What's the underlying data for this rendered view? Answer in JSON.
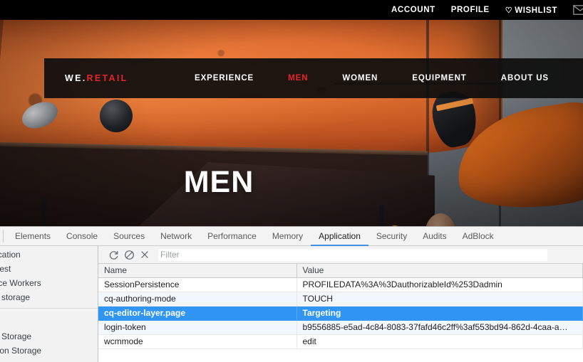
{
  "site": {
    "topbar": {
      "links": [
        {
          "label": "ACCOUNT",
          "name": "account-link"
        },
        {
          "label": "PROFILE",
          "name": "profile-link"
        },
        {
          "label": "WISHLIST",
          "name": "wishlist-link",
          "icon": "heart-icon",
          "icon_glyph": "♡"
        }
      ],
      "mail_icon": "mail-icon"
    },
    "brand": {
      "prefix": "WE.",
      "suffix": "RETAIL",
      "accent_color": "#e8242a"
    },
    "nav": [
      {
        "label": "EXPERIENCE",
        "active": false
      },
      {
        "label": "MEN",
        "active": true
      },
      {
        "label": "WOMEN",
        "active": false
      },
      {
        "label": "EQUIPMENT",
        "active": false
      },
      {
        "label": "ABOUT US",
        "active": false
      }
    ],
    "hero": {
      "title": "MEN"
    }
  },
  "devtools": {
    "tabs": [
      {
        "label": "Elements",
        "active": false
      },
      {
        "label": "Console",
        "active": false
      },
      {
        "label": "Sources",
        "active": false
      },
      {
        "label": "Network",
        "active": false
      },
      {
        "label": "Performance",
        "active": false
      },
      {
        "label": "Memory",
        "active": false
      },
      {
        "label": "Application",
        "active": true
      },
      {
        "label": "Security",
        "active": false
      },
      {
        "label": "Audits",
        "active": false
      },
      {
        "label": "AdBlock",
        "active": false
      }
    ],
    "sidebar": {
      "items": [
        {
          "label": "Application",
          "type": "item"
        },
        {
          "label": "Manifest",
          "type": "item"
        },
        {
          "label": "Service Workers",
          "type": "item"
        },
        {
          "label": "Clear storage",
          "type": "item"
        },
        {
          "label": "Local Storage",
          "type": "item"
        },
        {
          "label": "Session Storage",
          "type": "item"
        }
      ]
    },
    "toolbar": {
      "refresh_icon": "refresh-icon",
      "clear_icon": "clear-icon",
      "delete_icon": "delete-icon",
      "filter_placeholder": "Filter",
      "filter_value": ""
    },
    "table": {
      "columns": [
        "Name",
        "Value"
      ],
      "rows": [
        {
          "name": "SessionPersistence",
          "value": "PROFILEDATA%3A%3DauthorizableId%253Dadmin",
          "selected": false
        },
        {
          "name": "cq-authoring-mode",
          "value": "TOUCH",
          "selected": false
        },
        {
          "name": "cq-editor-layer.page",
          "value": "Targeting",
          "selected": true
        },
        {
          "name": "login-token",
          "value": "b9556885-e5ad-4c84-8083-37fafd46c2ff%3af553bd94-862d-4caa-a…",
          "selected": false
        },
        {
          "name": "wcmmode",
          "value": "edit",
          "selected": false
        }
      ],
      "selection_color": "#3196f3"
    }
  }
}
